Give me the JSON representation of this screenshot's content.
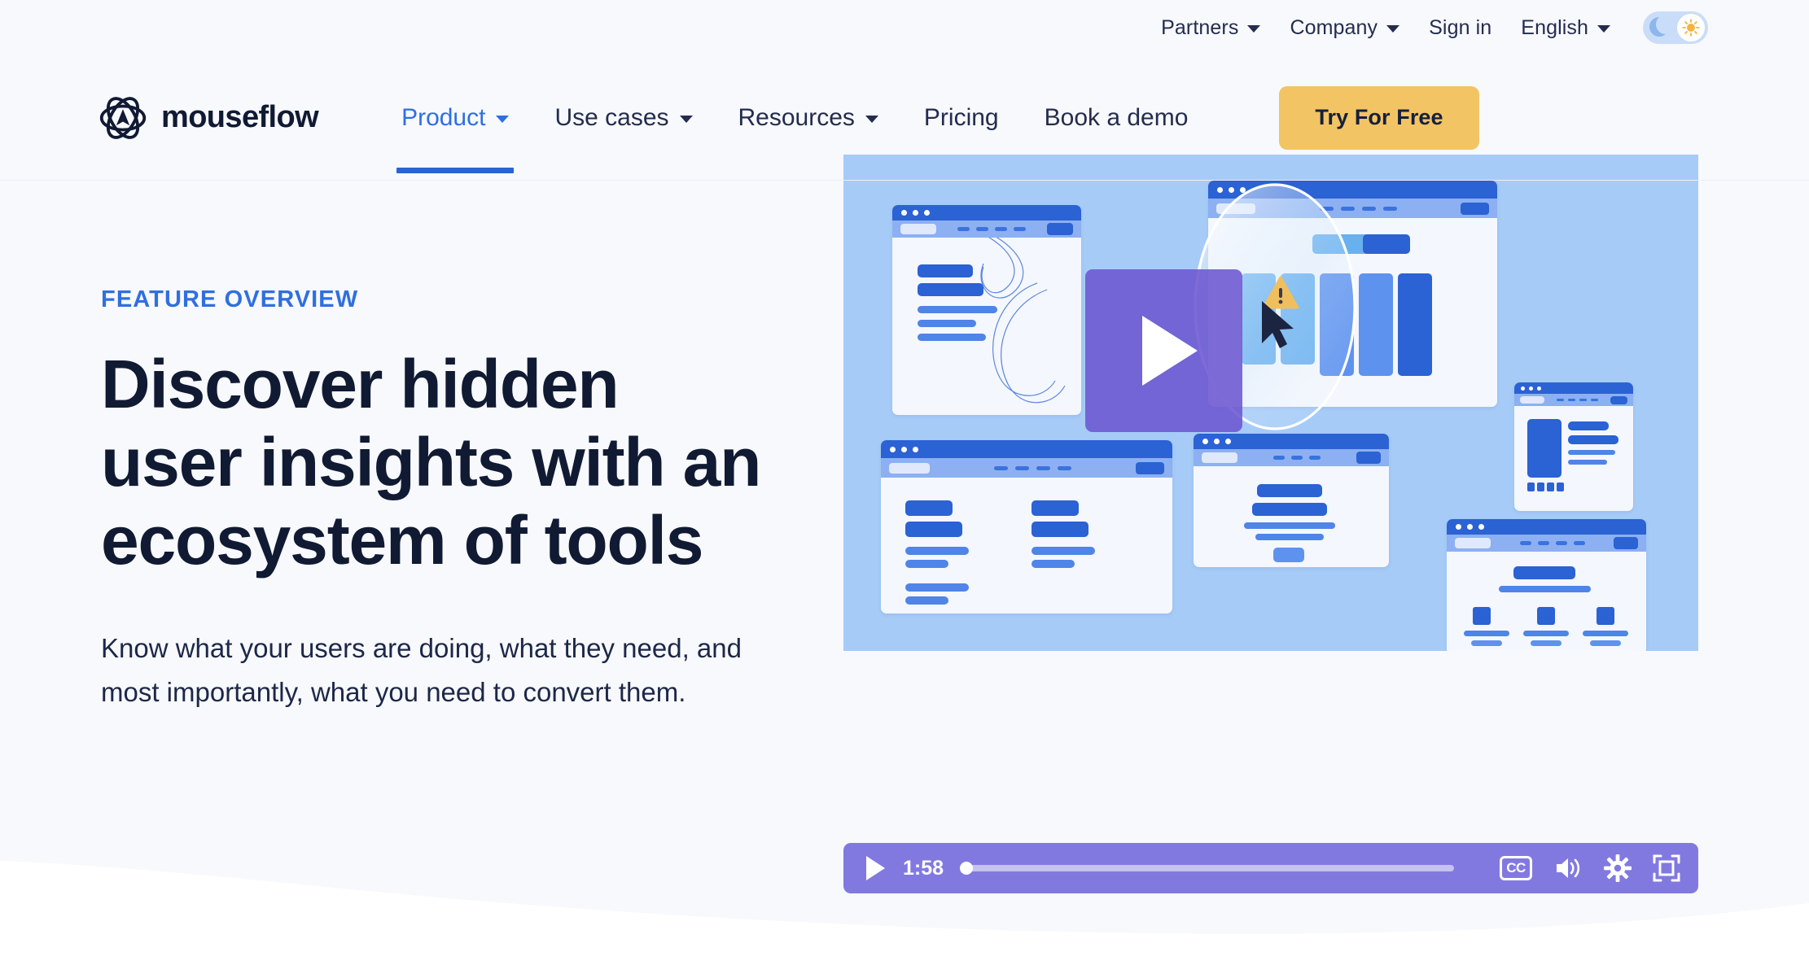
{
  "utilbar": {
    "items": [
      {
        "label": "Partners",
        "icon": "chevron-down-icon",
        "has_caret": true
      },
      {
        "label": "Company",
        "icon": "chevron-down-icon",
        "has_caret": true
      },
      {
        "label": "Sign in",
        "has_caret": false
      },
      {
        "label": "English",
        "icon": "chevron-down-icon",
        "has_caret": true
      }
    ],
    "theme_toggle": {
      "dark_icon": "moon-icon",
      "light_icon": "sun-icon",
      "state": "light",
      "track_color": "#c9ddf8",
      "moon_color": "#8cb6ee",
      "sun_color": "#f2b441"
    }
  },
  "navbar": {
    "logo_icon": "mouseflow-atom-logo-icon",
    "brand": "mouseflow",
    "links": [
      {
        "label": "Product",
        "has_caret": true,
        "active": true
      },
      {
        "label": "Use cases",
        "has_caret": true,
        "active": false
      },
      {
        "label": "Resources",
        "has_caret": true,
        "active": false
      },
      {
        "label": "Pricing",
        "has_caret": false,
        "active": false
      },
      {
        "label": "Book a demo",
        "has_caret": false,
        "active": false
      }
    ],
    "cta_label": "Try For Free",
    "cta_color": "#f2c464",
    "active_color": "#2f6fe0"
  },
  "hero": {
    "eyebrow": "FEATURE OVERVIEW",
    "headline": "Discover hidden user insights with an ecosystem of tools",
    "subcopy": "Know what your users are doing, what they need, and most importantly, what you need to convert them.",
    "eyebrow_color": "#2f6fe0",
    "headline_color": "#111a33",
    "background_color": "#f7f9fd"
  },
  "video": {
    "thumbnail_bg": "#a6cbf7",
    "play_button_icon": "play-icon",
    "play_overlay_color": "#6c56d0",
    "illustration": {
      "description": "Illustration of multiple blue browser-window wireframes with a magnifier circle, warning triangle and mouse cursor",
      "highlight_icon": "magnifier-circle-icon",
      "warning_icon": "warning-triangle-icon",
      "cursor_icon": "mouse-cursor-icon"
    },
    "controls": {
      "play_icon": "play-icon",
      "time": "1:58",
      "progress_percent": 0,
      "cc_label": "CC",
      "cc_icon": "closed-captions-icon",
      "volume_icon": "volume-icon",
      "settings_icon": "gear-icon",
      "fullscreen_icon": "fullscreen-icon",
      "bar_color": "#8279e0"
    }
  }
}
